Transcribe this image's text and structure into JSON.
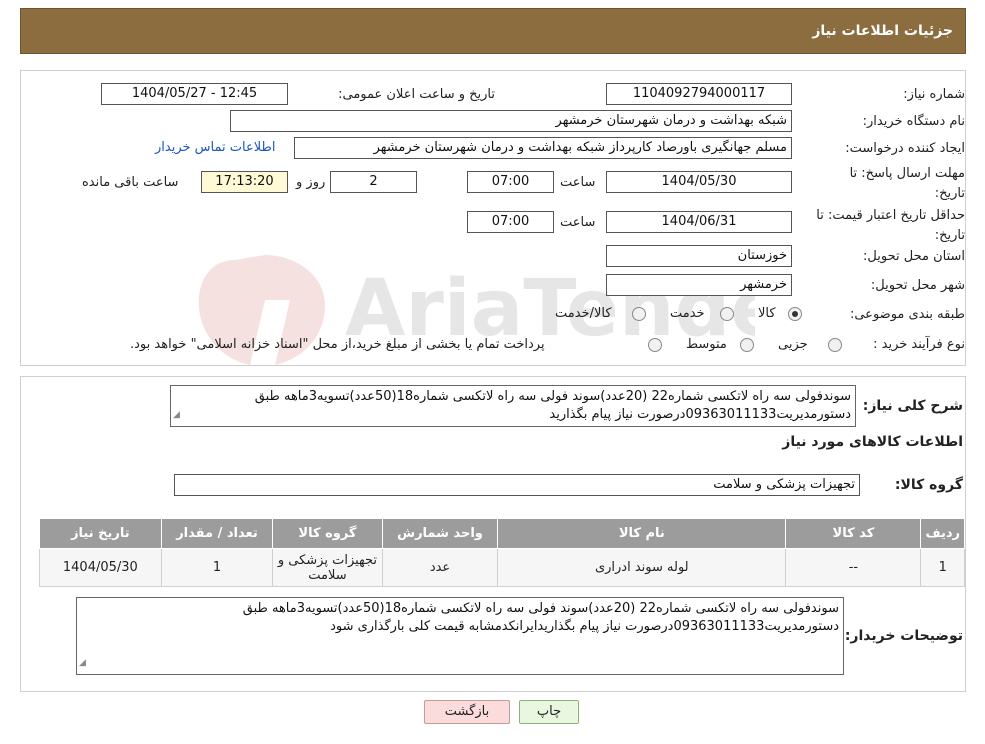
{
  "header": {
    "title": "جزئیات اطلاعات نیاز"
  },
  "need_number": {
    "label": "شماره نیاز:",
    "value": "1104092794000117"
  },
  "announce_date": {
    "label": "تاریخ و ساعت اعلان عمومی:",
    "value": "1404/05/27 - 12:45"
  },
  "buyer_org": {
    "label": "نام دستگاه خریدار:",
    "value": "شبکه بهداشت و درمان شهرستان خرمشهر"
  },
  "requester": {
    "label": "ایجاد کننده درخواست:",
    "value": "مسلم جهانگیری باورصاد کارپرداز شبکه بهداشت و درمان شهرستان خرمشهر",
    "contact_link": "اطلاعات تماس خریدار"
  },
  "send_deadline": {
    "label": "مهلت ارسال پاسخ: تا تاریخ:",
    "date": "1404/05/30",
    "time_label": "ساعت",
    "time": "07:00",
    "days": "2",
    "days_label": "روز و",
    "remaining": "17:13:20",
    "remaining_label": "ساعت باقی مانده"
  },
  "price_validity": {
    "label": "حداقل تاریخ اعتبار قیمت: تا تاریخ:",
    "date": "1404/06/31",
    "time_label": "ساعت",
    "time": "07:00"
  },
  "province": {
    "label": "استان محل تحویل:",
    "value": "خوزستان"
  },
  "city": {
    "label": "شهر محل تحویل:",
    "value": "خرمشهر"
  },
  "category": {
    "label": "طبقه بندی موضوعی:",
    "options": [
      "کالا",
      "خدمت",
      "کالا/خدمت"
    ],
    "selected": "کالا"
  },
  "purchase_type": {
    "label": "نوع فرآیند خرید :",
    "options": [
      "جزیی",
      "متوسط"
    ],
    "note": "پرداخت تمام یا بخشی از مبلغ خرید،از محل \"اسناد خزانه اسلامی\" خواهد بود."
  },
  "general_desc": {
    "label": "شرح کلی نیاز:",
    "value": "سوندفولی سه راه لاتکسی شماره22 (20عدد)سوند فولی سه راه لاتکسی شماره18(50عدد)تسویه3ماهه طبق دستورمدیریت09363011133درصورت نیاز پیام بگذارید"
  },
  "items_section_title": "اطلاعات کالاهای مورد نیاز",
  "goods_group": {
    "label": "گروه کالا:",
    "value": "تجهیزات پزشکی و سلامت"
  },
  "table": {
    "headers": [
      "ردیف",
      "کد کالا",
      "نام کالا",
      "واحد شمارش",
      "گروه کالا",
      "تعداد / مقدار",
      "تاریخ نیاز"
    ],
    "rows": [
      [
        "1",
        "--",
        "لوله سوند ادراری",
        "عدد",
        "تجهیزات پزشکی و سلامت",
        "1",
        "1404/05/30"
      ]
    ]
  },
  "buyer_notes": {
    "label": "توضیحات خریدار:",
    "value": "سوندفولی سه راه لاتکسی شماره22 (20عدد)سوند فولی سه راه لاتکسی شماره18(50عدد)تسویه3ماهه طبق دستورمدیریت09363011133درصورت نیاز پیام بگذاریدایرانکدمشابه قیمت کلی بارگذاری شود"
  },
  "buttons": {
    "print": "چاپ",
    "back": "بازگشت"
  },
  "colors": {
    "header_bg": "#8B6D3F",
    "table_header_bg": "#9C9C9C",
    "link": "#1a55c4"
  }
}
